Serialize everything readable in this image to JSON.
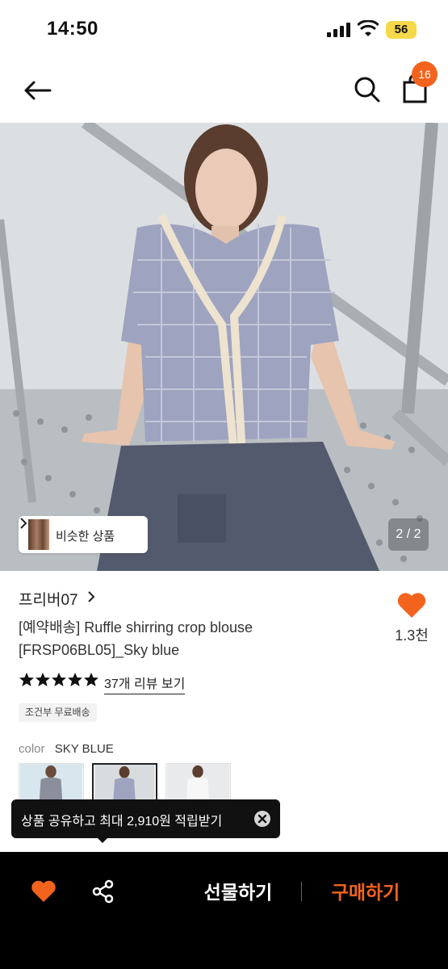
{
  "status_bar": {
    "time": "14:50",
    "battery": "56",
    "icons": [
      "signal-icon",
      "wifi-icon"
    ]
  },
  "header": {
    "icons": [
      "back-arrow-icon",
      "search-icon",
      "shopping-bag-icon"
    ],
    "cart_count": "16"
  },
  "hero": {
    "image": "model wearing blue gingham ruffle blouse sitting on metal scaffold",
    "similar_label": "비슷한 상품",
    "page_indicator": "2 / 2"
  },
  "product": {
    "brand": "프리버07",
    "title_line1": "[예약배송] Ruffle shirring crop blouse",
    "title_line2": "[FRSP06BL05]_Sky blue",
    "like_count": "1.3천",
    "rating": 5,
    "review_link": "37개 리뷰 보기",
    "shipping_tag": "조건부 무료배송",
    "color_key": "color",
    "color_value": "SKY BLUE",
    "swatches": [
      "swatch-1",
      "swatch-2",
      "swatch-3"
    ],
    "selected_swatch": 1
  },
  "tooltip": {
    "text": "상품 공유하고 최대 2,910원 적립받기"
  },
  "bottom_bar": {
    "gift_label": "선물하기",
    "buy_label": "구매하기"
  },
  "colors": {
    "accent": "#f4631e",
    "heart": "#f4631e",
    "bottom_bar_bg": "#000000",
    "battery": "#f5d94a"
  }
}
